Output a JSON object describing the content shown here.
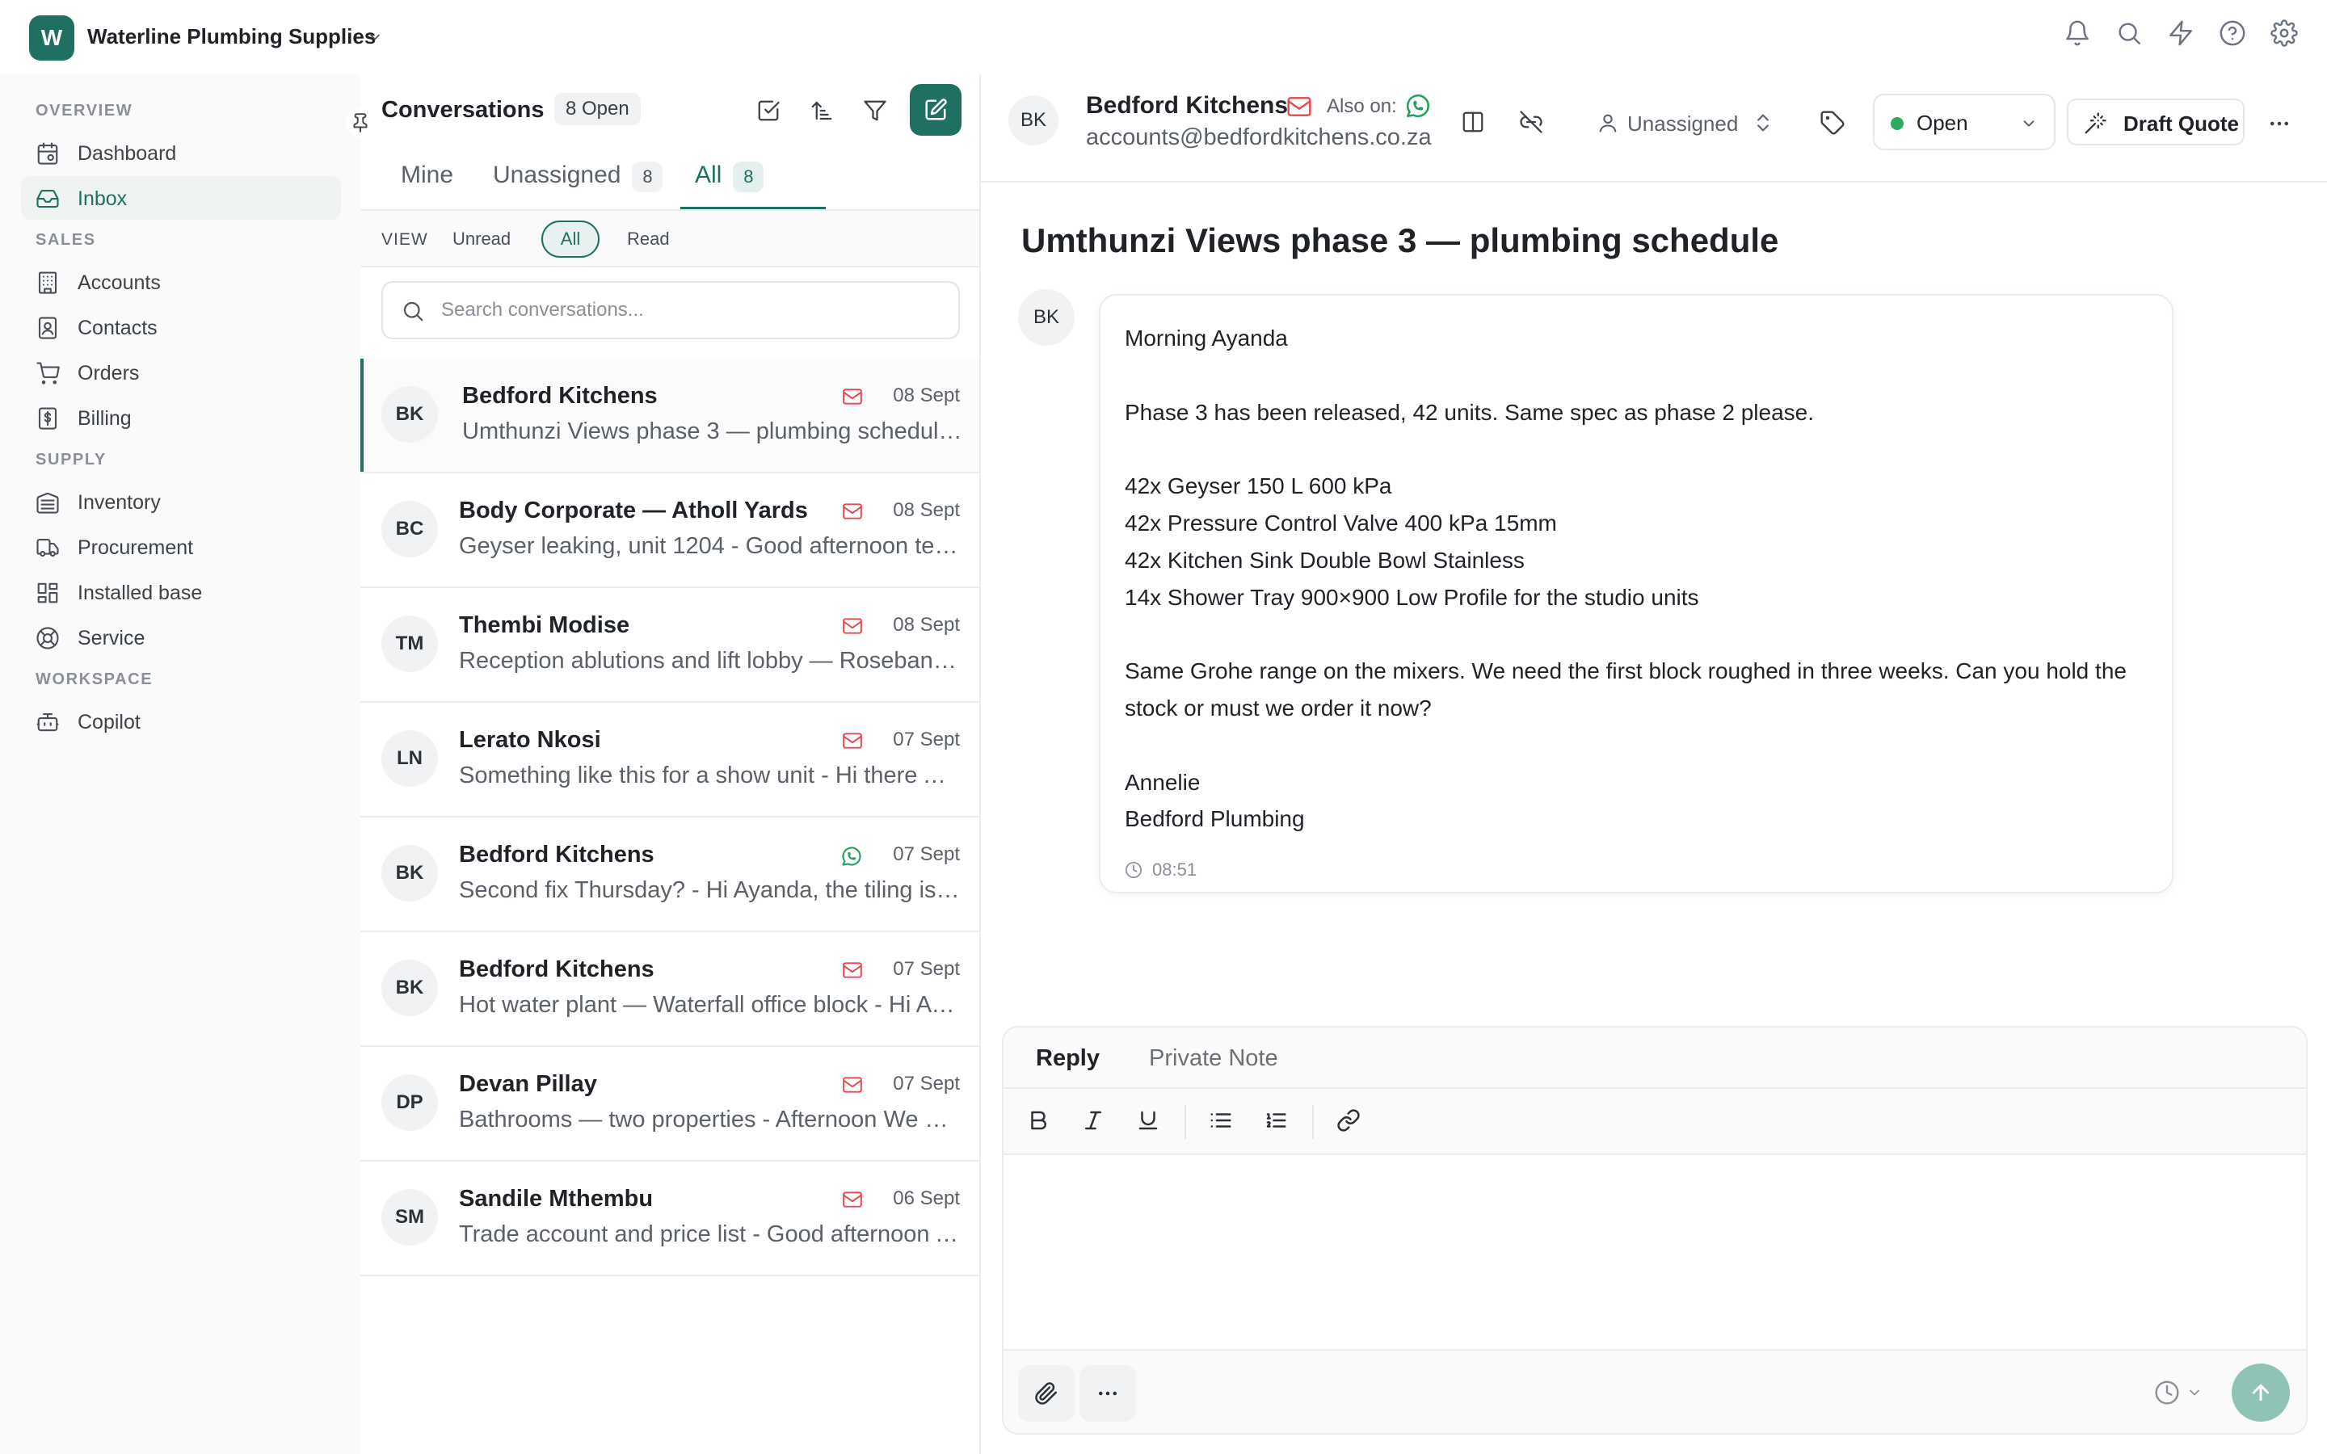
{
  "org": {
    "initial": "W",
    "name": "Waterline Plumbing Supplies"
  },
  "topbar": {
    "icons": [
      "bell-icon",
      "search-icon",
      "bolt-icon",
      "help-icon",
      "gear-icon"
    ]
  },
  "sidebar": {
    "sections": [
      {
        "label": "OVERVIEW",
        "items": [
          {
            "label": "Dashboard",
            "icon": "calendar-icon"
          },
          {
            "label": "Inbox",
            "icon": "inbox-icon",
            "active": true
          }
        ]
      },
      {
        "label": "SALES",
        "items": [
          {
            "label": "Accounts",
            "icon": "building-icon"
          },
          {
            "label": "Contacts",
            "icon": "contact-card-icon"
          },
          {
            "label": "Orders",
            "icon": "cart-icon"
          },
          {
            "label": "Billing",
            "icon": "invoice-icon"
          }
        ]
      },
      {
        "label": "SUPPLY",
        "items": [
          {
            "label": "Inventory",
            "icon": "warehouse-icon"
          },
          {
            "label": "Procurement",
            "icon": "truck-icon"
          },
          {
            "label": "Installed base",
            "icon": "grid-icon"
          },
          {
            "label": "Service",
            "icon": "lifebuoy-icon"
          }
        ]
      },
      {
        "label": "WORKSPACE",
        "items": [
          {
            "label": "Copilot",
            "icon": "robot-icon"
          }
        ]
      }
    ]
  },
  "conversations": {
    "title": "Conversations",
    "open_badge": "8 Open",
    "tabs": [
      {
        "label": "Mine",
        "count": ""
      },
      {
        "label": "Unassigned",
        "count": "8"
      },
      {
        "label": "All",
        "count": "8",
        "active": true
      }
    ],
    "view": {
      "label": "VIEW",
      "options": [
        "Unread",
        "All",
        "Read"
      ],
      "selected": "All"
    },
    "search_placeholder": "Search conversations...",
    "items": [
      {
        "initials": "BK",
        "name": "Bedford Kitchens",
        "channel": "email",
        "date": "08 Sept",
        "preview": "Umthunzi Views phase 3 — plumbing schedule - Morning Ayanda",
        "selected": true
      },
      {
        "initials": "BC",
        "name": "Body Corporate — Atholl Yards",
        "channel": "email",
        "date": "08 Sept",
        "preview": "Geyser leaking, unit 1204 - Good afternoon team"
      },
      {
        "initials": "TM",
        "name": "Thembi Modise",
        "channel": "email",
        "date": "08 Sept",
        "preview": "Reception ablutions and lift lobby — Rosebank office"
      },
      {
        "initials": "LN",
        "name": "Lerato Nkosi",
        "channel": "email",
        "date": "07 Sept",
        "preview": "Something like this for a show unit - Hi there Ayanda"
      },
      {
        "initials": "BK",
        "name": "Bedford Kitchens",
        "channel": "whatsapp",
        "date": "07 Sept",
        "preview": "Second fix Thursday? - Hi Ayanda, the tiling is done"
      },
      {
        "initials": "BK",
        "name": "Bedford Kitchens",
        "channel": "email",
        "date": "07 Sept",
        "preview": "Hot water plant — Waterfall office block - Hi Ayanda"
      },
      {
        "initials": "DP",
        "name": "Devan Pillay",
        "channel": "email",
        "date": "07 Sept",
        "preview": "Bathrooms — two properties - Afternoon We need"
      },
      {
        "initials": "SM",
        "name": "Sandile Mthembu",
        "channel": "email",
        "date": "06 Sept",
        "preview": "Trade account and price list - Good afternoon Ayanda"
      }
    ]
  },
  "detail": {
    "contact": {
      "initials": "BK",
      "name": "Bedford Kitchens",
      "email": "accounts@bedfordkitchens.co.za",
      "also_on_label": "Also on:"
    },
    "assignee": "Unassigned",
    "status": {
      "label": "Open",
      "color": "#2eaa5f"
    },
    "draft_quote_label": "Draft Quote",
    "subject": "Umthunzi Views phase 3 — plumbing schedule",
    "message": {
      "sender_initials": "BK",
      "greeting": "Morning Ayanda",
      "intro": "Phase 3 has been released, 42 units. Same spec as phase 2 please.",
      "lines": [
        "42x Geyser 150 L 600 kPa",
        "42x Pressure Control Valve 400 kPa 15mm",
        "42x Kitchen Sink Double Bowl Stainless",
        "14x Shower Tray 900×900 Low Profile for the studio units"
      ],
      "body": "Same Grohe range on the mixers. We need the first block roughed in three weeks. Can you hold the stock or must we order it now?",
      "signature_name": "Annelie",
      "signature_company": "Bedford Plumbing",
      "time": "08:51"
    }
  },
  "composer": {
    "tabs": [
      {
        "label": "Reply",
        "active": true
      },
      {
        "label": "Private Note"
      }
    ],
    "editor_value": ""
  },
  "colors": {
    "brand": "#1f6f63",
    "email": "#e5484d",
    "whatsapp": "#25a05a",
    "send_button": "#8ec3b6"
  }
}
